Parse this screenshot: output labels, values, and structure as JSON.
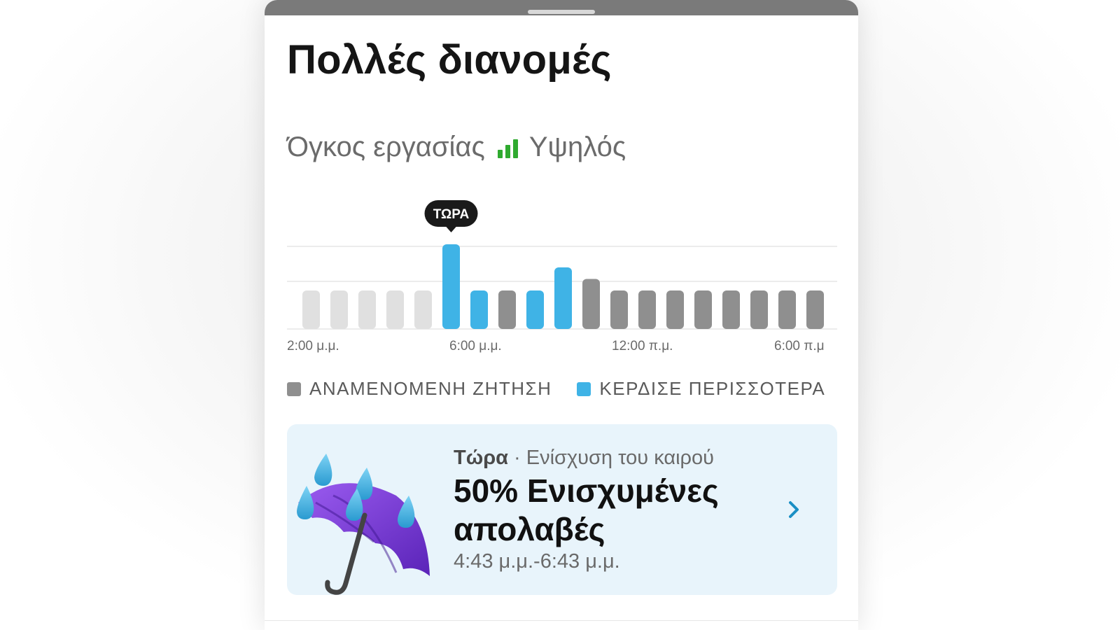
{
  "sheet": {
    "title": "Πολλές διανομές",
    "workload": {
      "label": "Όγκος εργασίας",
      "level": "Υψηλός",
      "signal_color": "#2faa2f"
    }
  },
  "chart_data": {
    "type": "bar",
    "x_ticks": [
      "2:00 μ.μ.",
      "6:00 μ.μ.",
      "12:00 π.μ.",
      "6:00 π.μ"
    ],
    "bars": [
      {
        "value": 1,
        "kind": "past"
      },
      {
        "value": 1,
        "kind": "past"
      },
      {
        "value": 1,
        "kind": "past"
      },
      {
        "value": 1,
        "kind": "past"
      },
      {
        "value": 1,
        "kind": "past"
      },
      {
        "value": 2.2,
        "kind": "earn_more"
      },
      {
        "value": 1,
        "kind": "earn_more"
      },
      {
        "value": 1,
        "kind": "expected"
      },
      {
        "value": 1,
        "kind": "earn_more"
      },
      {
        "value": 1.6,
        "kind": "earn_more"
      },
      {
        "value": 1.3,
        "kind": "expected"
      },
      {
        "value": 1,
        "kind": "expected"
      },
      {
        "value": 1,
        "kind": "expected"
      },
      {
        "value": 1,
        "kind": "expected"
      },
      {
        "value": 1,
        "kind": "expected"
      },
      {
        "value": 1,
        "kind": "expected"
      },
      {
        "value": 1,
        "kind": "expected"
      },
      {
        "value": 1,
        "kind": "expected"
      },
      {
        "value": 1,
        "kind": "expected"
      }
    ],
    "now_index": 5,
    "now_label": "ΤΩΡΑ",
    "ylim": [
      0,
      2.2
    ],
    "grid": true,
    "legend": [
      {
        "label": "ΑΝΑΜΕΝΟΜΕΝΗ ΖΗΤΗΣΗ",
        "color": "#8f8f8f"
      },
      {
        "label": "ΚΕΡΔΙΣΕ ΠΕΡΙΣΣΟΤΕΡΑ",
        "color": "#3fb3e6"
      }
    ],
    "colors": {
      "past": "#e0e0e0",
      "expected": "#8f8f8f",
      "earn_more": "#3fb3e6"
    }
  },
  "promo": {
    "now": "Τώρα",
    "subtitle": "· Ενίσχυση του καιρού",
    "title": "50% Ενισχυμένες απολαβές",
    "time_range": "4:43 μ.μ.-6:43 μ.μ.",
    "icon": "umbrella-rain-icon",
    "chevron_icon": "chevron-right-icon",
    "accent_color": "#1a8fc4"
  }
}
